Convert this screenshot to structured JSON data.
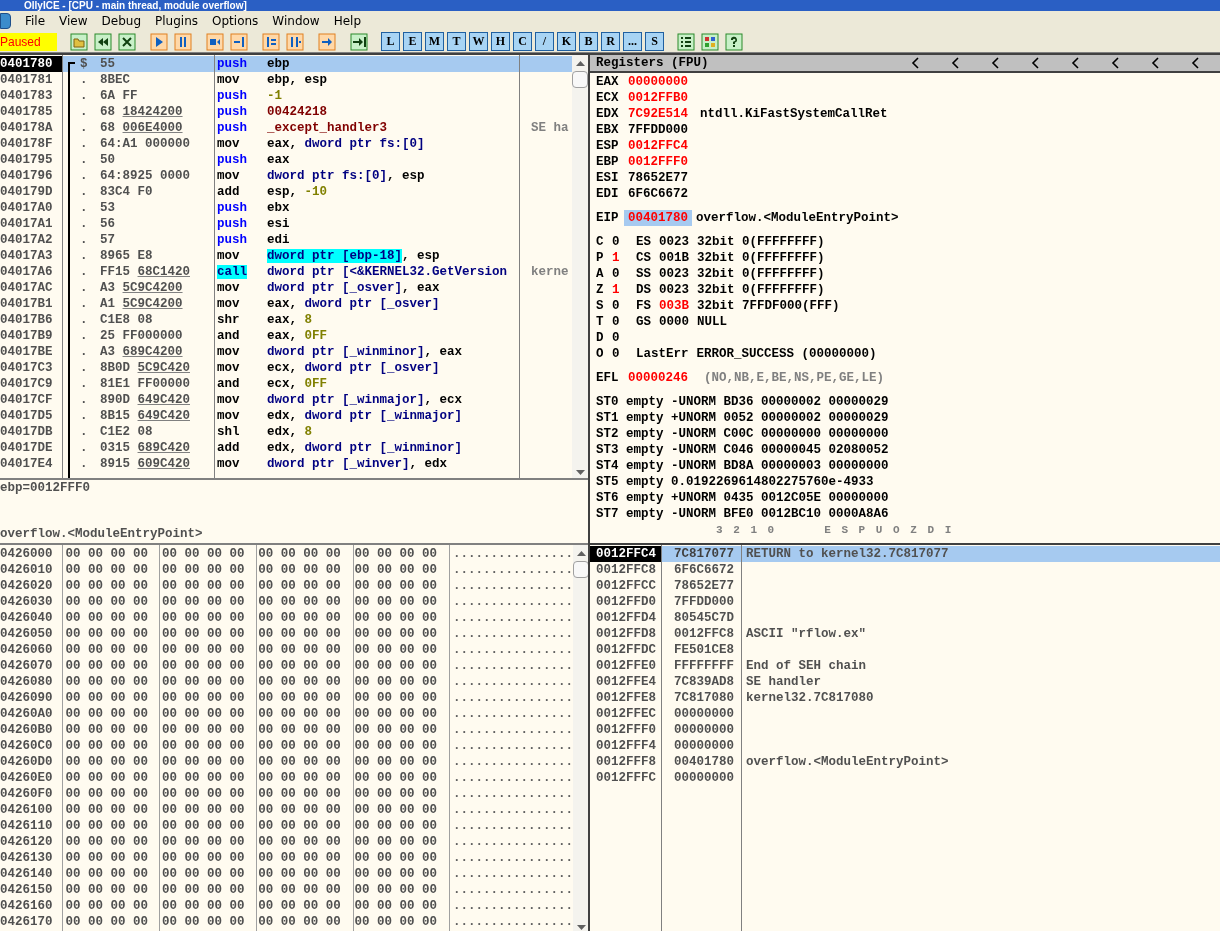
{
  "window": {
    "title": "OllyICE - [CPU - main thread, module overflow]"
  },
  "menu": [
    "File",
    "View",
    "Debug",
    "Plugins",
    "Options",
    "Window",
    "Help"
  ],
  "toolbar": {
    "status": "Paused",
    "window_buttons": [
      "L",
      "E",
      "M",
      "T",
      "W",
      "H",
      "C",
      "/",
      "K",
      "B",
      "R",
      "...",
      "S"
    ]
  },
  "disassembly": {
    "rows": [
      {
        "address": "0401780",
        "marker": "$",
        "hex": "55",
        "selected": true,
        "mnemonic": "push",
        "kind": "stack",
        "operand": [
          {
            "text": "ebp",
            "kind": "plain"
          }
        ]
      },
      {
        "address": "0401781",
        "marker": ".",
        "hex": "8BEC",
        "selected": false,
        "mnemonic": "mov",
        "kind": "other",
        "operand": [
          {
            "text": "ebp, esp",
            "kind": "plain"
          }
        ]
      },
      {
        "address": "0401783",
        "marker": ".",
        "hex": "6A FF",
        "selected": false,
        "mnemonic": "push",
        "kind": "stack",
        "operand": [
          {
            "text": "-1",
            "kind": "const"
          }
        ]
      },
      {
        "address": "0401785",
        "marker": ".",
        "hex": "68",
        "ref": "18424200",
        "selected": false,
        "mnemonic": "push",
        "kind": "stack",
        "operand": [
          {
            "text": "00424218",
            "kind": "sym"
          }
        ]
      },
      {
        "address": "040178A",
        "marker": ".",
        "hex": "68",
        "ref": "006E4000",
        "selected": false,
        "mnemonic": "push",
        "kind": "stack",
        "operand": [
          {
            "text": "_except_handler3",
            "kind": "sym"
          }
        ],
        "comment": "SE ha"
      },
      {
        "address": "040178F",
        "marker": ".",
        "hex": "64:A1 000000",
        "selected": false,
        "mnemonic": "mov",
        "kind": "other",
        "operand": [
          {
            "text": "eax, ",
            "kind": "plain"
          },
          {
            "text": "dword ptr fs:[0]",
            "kind": "mem"
          }
        ]
      },
      {
        "address": "0401795",
        "marker": ".",
        "hex": "50",
        "selected": false,
        "mnemonic": "push",
        "kind": "stack",
        "operand": [
          {
            "text": "eax",
            "kind": "plain"
          }
        ]
      },
      {
        "address": "0401796",
        "marker": ".",
        "hex": "64:8925 0000",
        "selected": false,
        "mnemonic": "mov",
        "kind": "other",
        "operand": [
          {
            "text": "dword ptr fs:[0]",
            "kind": "mem"
          },
          {
            "text": ", esp",
            "kind": "plain"
          }
        ]
      },
      {
        "address": "040179D",
        "marker": ".",
        "hex": "83C4 F0",
        "selected": false,
        "mnemonic": "add",
        "kind": "other",
        "operand": [
          {
            "text": "esp, ",
            "kind": "plain"
          },
          {
            "text": "-10",
            "kind": "const"
          }
        ]
      },
      {
        "address": "04017A0",
        "marker": ".",
        "hex": "53",
        "selected": false,
        "mnemonic": "push",
        "kind": "stack",
        "operand": [
          {
            "text": "ebx",
            "kind": "plain"
          }
        ]
      },
      {
        "address": "04017A1",
        "marker": ".",
        "hex": "56",
        "selected": false,
        "mnemonic": "push",
        "kind": "stack",
        "operand": [
          {
            "text": "esi",
            "kind": "plain"
          }
        ]
      },
      {
        "address": "04017A2",
        "marker": ".",
        "hex": "57",
        "selected": false,
        "mnemonic": "push",
        "kind": "stack",
        "operand": [
          {
            "text": "edi",
            "kind": "plain"
          }
        ]
      },
      {
        "address": "04017A3",
        "marker": ".",
        "hex": "8965 E8",
        "selected": false,
        "mnemonic": "mov",
        "kind": "other",
        "operand": [
          {
            "text": "dword ptr [ebp-18]",
            "kind": "hl"
          },
          {
            "text": ", esp",
            "kind": "plain"
          }
        ]
      },
      {
        "address": "04017A6",
        "marker": ".",
        "hex": "FF15",
        "ref": "68C1420",
        "selected": false,
        "mnemonic": "call",
        "kind": "call",
        "operand": [
          {
            "text": "dword ptr [<&KERNEL32.GetVersion",
            "kind": "mem"
          }
        ],
        "comment": "kerne"
      },
      {
        "address": "04017AC",
        "marker": ".",
        "hex": "A3",
        "ref": "5C9C4200",
        "selected": false,
        "mnemonic": "mov",
        "kind": "other",
        "operand": [
          {
            "text": "dword ptr [_osver]",
            "kind": "mem"
          },
          {
            "text": ", eax",
            "kind": "plain"
          }
        ]
      },
      {
        "address": "04017B1",
        "marker": ".",
        "hex": "A1",
        "ref": "5C9C4200",
        "selected": false,
        "mnemonic": "mov",
        "kind": "other",
        "operand": [
          {
            "text": "eax, ",
            "kind": "plain"
          },
          {
            "text": "dword ptr [_osver]",
            "kind": "mem"
          }
        ]
      },
      {
        "address": "04017B6",
        "marker": ".",
        "hex": "C1E8 08",
        "selected": false,
        "mnemonic": "shr",
        "kind": "other",
        "operand": [
          {
            "text": "eax, ",
            "kind": "plain"
          },
          {
            "text": "8",
            "kind": "const"
          }
        ]
      },
      {
        "address": "04017B9",
        "marker": ".",
        "hex": "25 FF000000",
        "selected": false,
        "mnemonic": "and",
        "kind": "other",
        "operand": [
          {
            "text": "eax, ",
            "kind": "plain"
          },
          {
            "text": "0FF",
            "kind": "const"
          }
        ]
      },
      {
        "address": "04017BE",
        "marker": ".",
        "hex": "A3",
        "ref": "689C4200",
        "selected": false,
        "mnemonic": "mov",
        "kind": "other",
        "operand": [
          {
            "text": "dword ptr [_winminor]",
            "kind": "mem"
          },
          {
            "text": ", eax",
            "kind": "plain"
          }
        ]
      },
      {
        "address": "04017C3",
        "marker": ".",
        "hex": "8B0D",
        "ref": "5C9C420",
        "selected": false,
        "mnemonic": "mov",
        "kind": "other",
        "operand": [
          {
            "text": "ecx, ",
            "kind": "plain"
          },
          {
            "text": "dword ptr [_osver]",
            "kind": "mem"
          }
        ]
      },
      {
        "address": "04017C9",
        "marker": ".",
        "hex": "81E1 FF00000",
        "selected": false,
        "mnemonic": "and",
        "kind": "other",
        "operand": [
          {
            "text": "ecx, ",
            "kind": "plain"
          },
          {
            "text": "0FF",
            "kind": "const"
          }
        ]
      },
      {
        "address": "04017CF",
        "marker": ".",
        "hex": "890D",
        "ref": "649C420",
        "selected": false,
        "mnemonic": "mov",
        "kind": "other",
        "operand": [
          {
            "text": "dword ptr [_winmajor]",
            "kind": "mem"
          },
          {
            "text": ", ecx",
            "kind": "plain"
          }
        ]
      },
      {
        "address": "04017D5",
        "marker": ".",
        "hex": "8B15",
        "ref": "649C420",
        "selected": false,
        "mnemonic": "mov",
        "kind": "other",
        "operand": [
          {
            "text": "edx, ",
            "kind": "plain"
          },
          {
            "text": "dword ptr [_winmajor]",
            "kind": "mem"
          }
        ]
      },
      {
        "address": "04017DB",
        "marker": ".",
        "hex": "C1E2 08",
        "selected": false,
        "mnemonic": "shl",
        "kind": "other",
        "operand": [
          {
            "text": "edx, ",
            "kind": "plain"
          },
          {
            "text": "8",
            "kind": "const"
          }
        ]
      },
      {
        "address": "04017DE",
        "marker": ".",
        "hex": "0315",
        "ref": "689C420",
        "selected": false,
        "mnemonic": "add",
        "kind": "other",
        "operand": [
          {
            "text": "edx, ",
            "kind": "plain"
          },
          {
            "text": "dword ptr [_winminor]",
            "kind": "mem"
          }
        ]
      },
      {
        "address": "04017E4",
        "marker": ".",
        "hex": "8915",
        "ref": "609C420",
        "selected": false,
        "mnemonic": "mov",
        "kind": "other",
        "operand": [
          {
            "text": "dword ptr [_winver]",
            "kind": "mem"
          },
          {
            "text": ", edx",
            "kind": "plain"
          }
        ]
      }
    ]
  },
  "info": [
    "ebp=0012FFF0",
    "overflow.<ModuleEntryPoint>"
  ],
  "registers": {
    "title": "Registers (FPU)",
    "gpr": [
      {
        "name": "EAX",
        "value": "00000000",
        "changed": true
      },
      {
        "name": "ECX",
        "value": "0012FFB0",
        "changed": true
      },
      {
        "name": "EDX",
        "value": "7C92E514",
        "changed": true,
        "comment": "ntdll.KiFastSystemCallRet"
      },
      {
        "name": "EBX",
        "value": "7FFDD000",
        "changed": false
      },
      {
        "name": "ESP",
        "value": "0012FFC4",
        "changed": true
      },
      {
        "name": "EBP",
        "value": "0012FFF0",
        "changed": true
      },
      {
        "name": "ESI",
        "value": "78652E77",
        "changed": false
      },
      {
        "name": "EDI",
        "value": "6F6C6672",
        "changed": false
      }
    ],
    "eip": {
      "name": "EIP",
      "value": "00401780",
      "changed": true,
      "selected": true,
      "comment": "overflow.<ModuleEntryPoint>"
    },
    "flags": [
      {
        "flag": "C",
        "bit": "0",
        "changed": false,
        "segment": "ES",
        "selector": "0023",
        "selector_changed": false,
        "info": "32bit 0(FFFFFFFF)"
      },
      {
        "flag": "P",
        "bit": "1",
        "changed": true,
        "segment": "CS",
        "selector": "001B",
        "selector_changed": false,
        "info": "32bit 0(FFFFFFFF)"
      },
      {
        "flag": "A",
        "bit": "0",
        "changed": false,
        "segment": "SS",
        "selector": "0023",
        "selector_changed": false,
        "info": "32bit 0(FFFFFFFF)"
      },
      {
        "flag": "Z",
        "bit": "1",
        "changed": true,
        "segment": "DS",
        "selector": "0023",
        "selector_changed": false,
        "info": "32bit 0(FFFFFFFF)"
      },
      {
        "flag": "S",
        "bit": "0",
        "changed": false,
        "segment": "FS",
        "selector": "003B",
        "selector_changed": true,
        "info": "32bit 7FFDF000(FFF)"
      },
      {
        "flag": "T",
        "bit": "0",
        "changed": false,
        "segment": "GS",
        "selector": "0000",
        "selector_changed": false,
        "info": "NULL"
      },
      {
        "flag": "D",
        "bit": "0",
        "changed": false
      },
      {
        "flag": "O",
        "bit": "0",
        "changed": false,
        "segment": "LastErr",
        "info": "ERROR_SUCCESS (00000000)"
      }
    ],
    "efl": {
      "name": "EFL",
      "value": "00000246",
      "changed": true,
      "decoded": "(NO,NB,E,BE,NS,PE,GE,LE)"
    },
    "fpu": [
      "ST0 empty -UNORM BD36 00000002 00000029",
      "ST1 empty +UNORM 0052 00000002 00000029",
      "ST2 empty -UNORM C00C 00000000 00000000",
      "ST3 empty -UNORM C046 00000045 02080052",
      "ST4 empty -UNORM BD8A 00000003 00000000",
      "ST5 empty 0.0192269614802275760e-4933",
      "ST6 empty +UNORM 0435 0012C05E 00000000",
      "ST7 empty -UNORM BFE0 0012BC10 0000A8A6"
    ],
    "fpu_footer": [
      "3 2 1 0",
      "E S P U O Z D I"
    ]
  },
  "dump": {
    "rows": [
      {
        "address": "0426000",
        "bytes": "00 00 00 00 00 00 00 00 00 00 00 00 00 00 00 00",
        "ascii": "................"
      },
      {
        "address": "0426010",
        "bytes": "00 00 00 00 00 00 00 00 00 00 00 00 00 00 00 00",
        "ascii": "................"
      },
      {
        "address": "0426020",
        "bytes": "00 00 00 00 00 00 00 00 00 00 00 00 00 00 00 00",
        "ascii": "................"
      },
      {
        "address": "0426030",
        "bytes": "00 00 00 00 00 00 00 00 00 00 00 00 00 00 00 00",
        "ascii": "................"
      },
      {
        "address": "0426040",
        "bytes": "00 00 00 00 00 00 00 00 00 00 00 00 00 00 00 00",
        "ascii": "................"
      },
      {
        "address": "0426050",
        "bytes": "00 00 00 00 00 00 00 00 00 00 00 00 00 00 00 00",
        "ascii": "................"
      },
      {
        "address": "0426060",
        "bytes": "00 00 00 00 00 00 00 00 00 00 00 00 00 00 00 00",
        "ascii": "................"
      },
      {
        "address": "0426070",
        "bytes": "00 00 00 00 00 00 00 00 00 00 00 00 00 00 00 00",
        "ascii": "................"
      },
      {
        "address": "0426080",
        "bytes": "00 00 00 00 00 00 00 00 00 00 00 00 00 00 00 00",
        "ascii": "................"
      },
      {
        "address": "0426090",
        "bytes": "00 00 00 00 00 00 00 00 00 00 00 00 00 00 00 00",
        "ascii": "................"
      },
      {
        "address": "04260A0",
        "bytes": "00 00 00 00 00 00 00 00 00 00 00 00 00 00 00 00",
        "ascii": "................"
      },
      {
        "address": "04260B0",
        "bytes": "00 00 00 00 00 00 00 00 00 00 00 00 00 00 00 00",
        "ascii": "................"
      },
      {
        "address": "04260C0",
        "bytes": "00 00 00 00 00 00 00 00 00 00 00 00 00 00 00 00",
        "ascii": "................"
      },
      {
        "address": "04260D0",
        "bytes": "00 00 00 00 00 00 00 00 00 00 00 00 00 00 00 00",
        "ascii": "................"
      },
      {
        "address": "04260E0",
        "bytes": "00 00 00 00 00 00 00 00 00 00 00 00 00 00 00 00",
        "ascii": "................"
      },
      {
        "address": "04260F0",
        "bytes": "00 00 00 00 00 00 00 00 00 00 00 00 00 00 00 00",
        "ascii": "................"
      },
      {
        "address": "0426100",
        "bytes": "00 00 00 00 00 00 00 00 00 00 00 00 00 00 00 00",
        "ascii": "................"
      },
      {
        "address": "0426110",
        "bytes": "00 00 00 00 00 00 00 00 00 00 00 00 00 00 00 00",
        "ascii": "................"
      },
      {
        "address": "0426120",
        "bytes": "00 00 00 00 00 00 00 00 00 00 00 00 00 00 00 00",
        "ascii": "................"
      },
      {
        "address": "0426130",
        "bytes": "00 00 00 00 00 00 00 00 00 00 00 00 00 00 00 00",
        "ascii": "................"
      },
      {
        "address": "0426140",
        "bytes": "00 00 00 00 00 00 00 00 00 00 00 00 00 00 00 00",
        "ascii": "................"
      },
      {
        "address": "0426150",
        "bytes": "00 00 00 00 00 00 00 00 00 00 00 00 00 00 00 00",
        "ascii": "................"
      },
      {
        "address": "0426160",
        "bytes": "00 00 00 00 00 00 00 00 00 00 00 00 00 00 00 00",
        "ascii": "................"
      },
      {
        "address": "0426170",
        "bytes": "00 00 00 00 00 00 00 00 00 00 00 00 00 00 00 00",
        "ascii": "................"
      }
    ]
  },
  "stack": {
    "rows": [
      {
        "address": "0012FFC4",
        "value": "7C817077",
        "comment": "RETURN to kernel32.7C817077",
        "selected": true
      },
      {
        "address": "0012FFC8",
        "value": "6F6C6672",
        "selected": false
      },
      {
        "address": "0012FFCC",
        "value": "78652E77",
        "selected": false
      },
      {
        "address": "0012FFD0",
        "value": "7FFDD000",
        "selected": false
      },
      {
        "address": "0012FFD4",
        "value": "80545C7D",
        "selected": false
      },
      {
        "address": "0012FFD8",
        "value": "0012FFC8",
        "comment": "ASCII \"rflow.ex\"",
        "selected": false
      },
      {
        "address": "0012FFDC",
        "value": "FE501CE8",
        "selected": false
      },
      {
        "address": "0012FFE0",
        "value": "FFFFFFFF",
        "comment": "End of SEH chain",
        "selected": false
      },
      {
        "address": "0012FFE4",
        "value": "7C839AD8",
        "comment": "SE handler",
        "selected": false
      },
      {
        "address": "0012FFE8",
        "value": "7C817080",
        "comment": "kernel32.7C817080",
        "selected": false
      },
      {
        "address": "0012FFEC",
        "value": "00000000",
        "selected": false
      },
      {
        "address": "0012FFF0",
        "value": "00000000",
        "selected": false
      },
      {
        "address": "0012FFF4",
        "value": "00000000",
        "selected": false
      },
      {
        "address": "0012FFF8",
        "value": "00401780",
        "comment": "overflow.<ModuleEntryPoint>",
        "selected": false
      },
      {
        "address": "0012FFFC",
        "value": "00000000",
        "selected": false
      }
    ]
  }
}
